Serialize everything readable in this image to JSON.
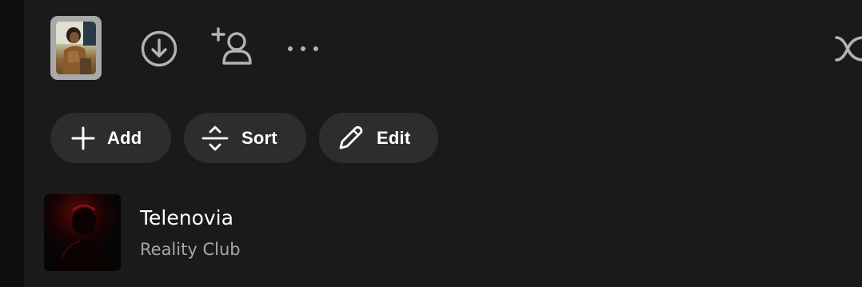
{
  "toolbar": {
    "cover_icon": "playlist-cover-thumbnail",
    "download_icon": "download-circle-icon",
    "add_user_icon": "add-user-icon",
    "more_icon": "more-options-icon",
    "shuffle_icon": "shuffle-icon"
  },
  "actions": {
    "add_label": "Add",
    "sort_label": "Sort",
    "edit_label": "Edit"
  },
  "tracks": [
    {
      "title": "Telenovia",
      "artist": "Reality Club"
    }
  ],
  "colors": {
    "background": "#1a1a1a",
    "pill_background": "#2d2d2d",
    "primary_text": "#ffffff",
    "secondary_text": "#a7a7a7",
    "icon": "#b3b3b3"
  }
}
